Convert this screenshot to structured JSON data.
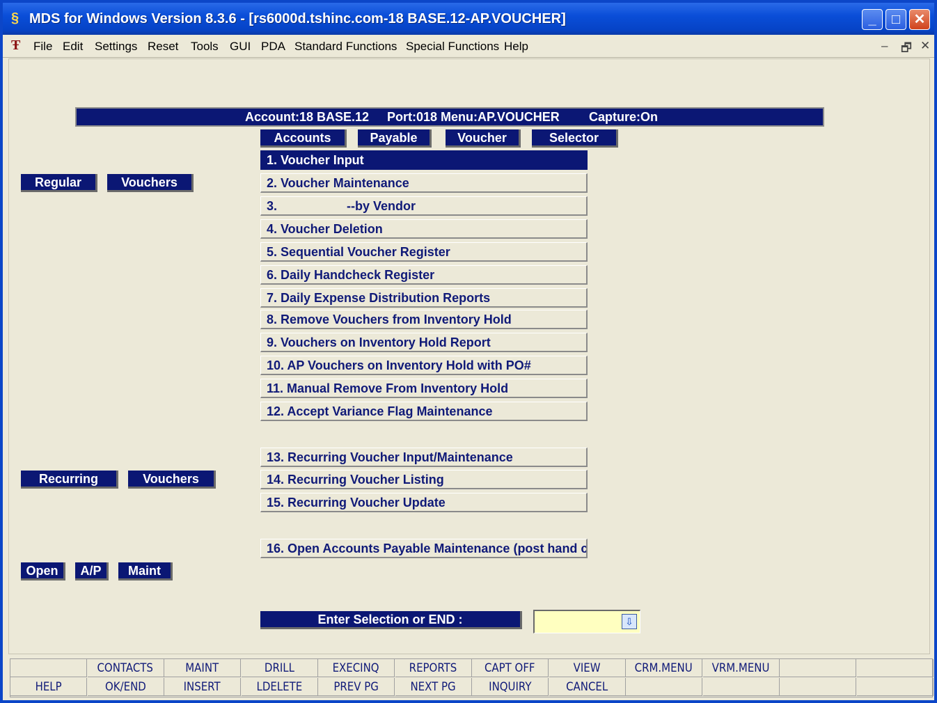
{
  "window": {
    "title": "MDS for Windows Version 8.3.6 - [rs6000d.tshinc.com-18 BASE.12-AP.VOUCHER]",
    "minimize": "_",
    "maximize": "□",
    "close": "✕"
  },
  "menubar": {
    "items": [
      "File",
      "Edit",
      "Settings",
      "Reset",
      "Tools",
      "GUI",
      "PDA",
      "Standard Functions",
      "Special Functions",
      "Help"
    ],
    "mdi": {
      "minimize": "–",
      "restore": "🗗",
      "close": "✕"
    }
  },
  "header": {
    "account": "Account:18 BASE.12",
    "port_menu": "Port:018 Menu:AP.VOUCHER",
    "capture": "Capture:On"
  },
  "top_labels": [
    "Accounts",
    "Payable",
    "Voucher",
    "Selector"
  ],
  "section_labels": {
    "regular": [
      "Regular",
      "Vouchers"
    ],
    "recurring": [
      "Recurring",
      "Vouchers"
    ],
    "open": [
      "Open",
      "A/P",
      "Maint"
    ]
  },
  "menu_items": [
    "1. Voucher Input",
    "2. Voucher Maintenance",
    "3.                    --by Vendor",
    "4. Voucher Deletion",
    "5. Sequential Voucher Register",
    "6. Daily Handcheck Register",
    "7. Daily Expense Distribution Reports",
    "8. Remove Vouchers from Inventory Hold",
    "9. Vouchers on Inventory Hold Report",
    "10. AP Vouchers on Inventory Hold with PO#",
    "11. Manual Remove From Inventory Hold",
    "12. Accept Variance Flag Maintenance",
    "13. Recurring Voucher Input/Maintenance",
    "14. Recurring Voucher Listing",
    "15. Recurring Voucher Update",
    "16. Open Accounts Payable Maintenance (post hand c"
  ],
  "selected_index": 0,
  "prompt": {
    "label": "Enter Selection or END :",
    "value": "",
    "dropdown_icon": "⇩"
  },
  "function_keys": {
    "row1": [
      "",
      "CONTACTS",
      "MAINT",
      "DRILL",
      "EXECINQ",
      "REPORTS",
      "CAPT OFF",
      "VIEW",
      "CRM.MENU",
      "VRM.MENU",
      "",
      ""
    ],
    "row2": [
      "HELP",
      "OK/END",
      "INSERT",
      "LDELETE",
      "PREV PG",
      "NEXT PG",
      "INQUIRY",
      "CANCEL",
      "",
      "",
      "",
      ""
    ]
  },
  "colors": {
    "title_bar": "#0a4ed8",
    "navy_label": "#0b1774",
    "background": "#ece9d8",
    "input_bg": "#ffffc0"
  }
}
